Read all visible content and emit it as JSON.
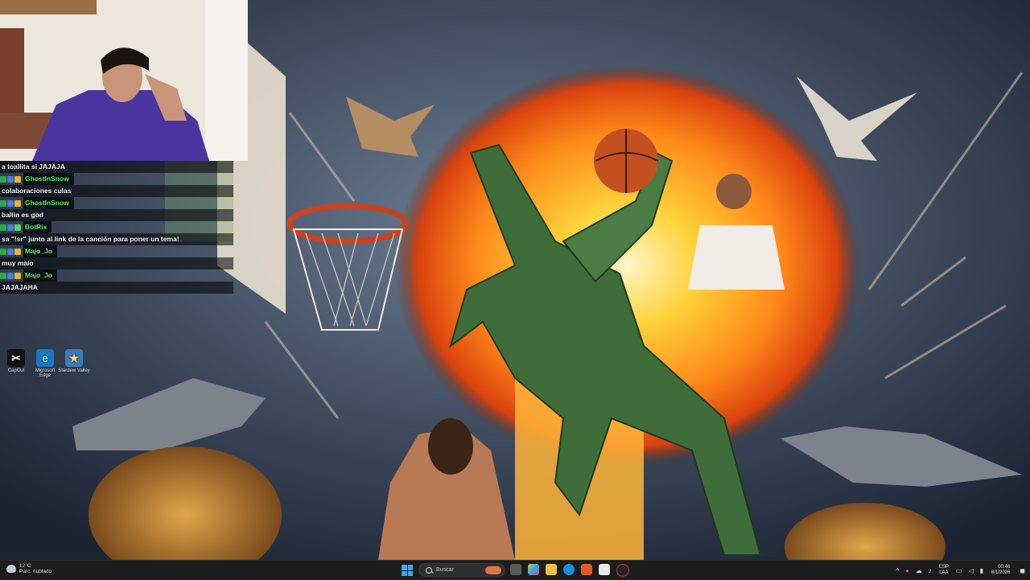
{
  "chat": [
    {
      "kind": "msg",
      "text": "a toallita si JAJAJA"
    },
    {
      "kind": "user",
      "name": "GhostInSnow"
    },
    {
      "kind": "msg",
      "text": "colaboraciones culas"
    },
    {
      "kind": "user",
      "name": "GhostInSnow"
    },
    {
      "kind": "msg",
      "text": "ballin es god"
    },
    {
      "kind": "user",
      "name": "BotRix"
    },
    {
      "kind": "msg",
      "text": "sa \"!sr\" junto al link de la canción para poner un tema!"
    },
    {
      "kind": "user",
      "name": "Majo_Jo"
    },
    {
      "kind": "msg",
      "text": "muy malo"
    },
    {
      "kind": "user",
      "name": "Majo_Jo"
    },
    {
      "kind": "msg",
      "text": "JAJAJAHA"
    }
  ],
  "desktop_icons": [
    {
      "label": "CapCut",
      "glyph": "✂",
      "bg": "#111111",
      "fg": "#ffffff"
    },
    {
      "label": "Microsoft Edge",
      "glyph": "e",
      "bg": "#1677c9",
      "fg": "#7df0b4"
    },
    {
      "label": "Stardew Valley",
      "glyph": "★",
      "bg": "#3b7bbf",
      "fg": "#ffdd66"
    }
  ],
  "taskbar": {
    "temperature": "12°C",
    "weather_desc": "Parc. nublado",
    "search_placeholder": "Buscar",
    "lang_line1": "ESP",
    "lang_line2": "LAA",
    "time": "00:46",
    "date": "8/1/2026"
  },
  "colors": {
    "username": "#4fff6a",
    "taskbar_bg": "#1c1c1c",
    "start_blue": "#3da7f3"
  }
}
